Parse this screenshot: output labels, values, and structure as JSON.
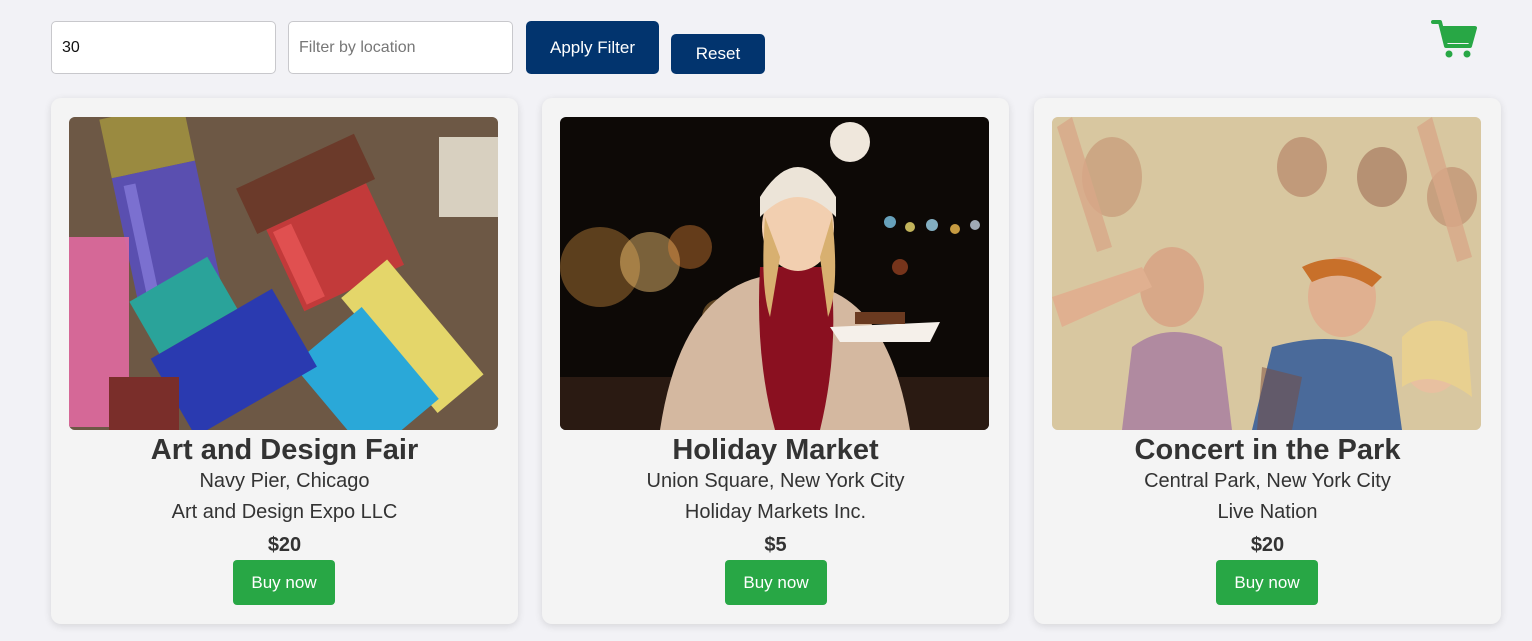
{
  "filters": {
    "price_value": "30",
    "location_placeholder": "Filter by location",
    "location_value": "",
    "apply_label": "Apply Filter",
    "reset_label": "Reset"
  },
  "cart": {
    "icon": "shopping-cart-icon",
    "color": "#28a745"
  },
  "colors": {
    "primary": "#02346e",
    "buy": "#28a745",
    "background": "#f2f2f6"
  },
  "events": [
    {
      "title": "Art and Design Fair",
      "location": "Navy Pier, Chicago",
      "organizer": "Art and Design Expo LLC",
      "price": "$20",
      "buy_label": "Buy now",
      "image": "paint-brushes-photo"
    },
    {
      "title": "Holiday Market",
      "location": "Union Square, New York City",
      "organizer": "Holiday Markets Inc.",
      "price": "$5",
      "buy_label": "Buy now",
      "image": "woman-at-holiday-market-photo"
    },
    {
      "title": "Concert in the Park",
      "location": "Central Park, New York City",
      "organizer": "Live Nation",
      "price": "$20",
      "buy_label": "Buy now",
      "image": "concert-crowd-photo"
    }
  ]
}
